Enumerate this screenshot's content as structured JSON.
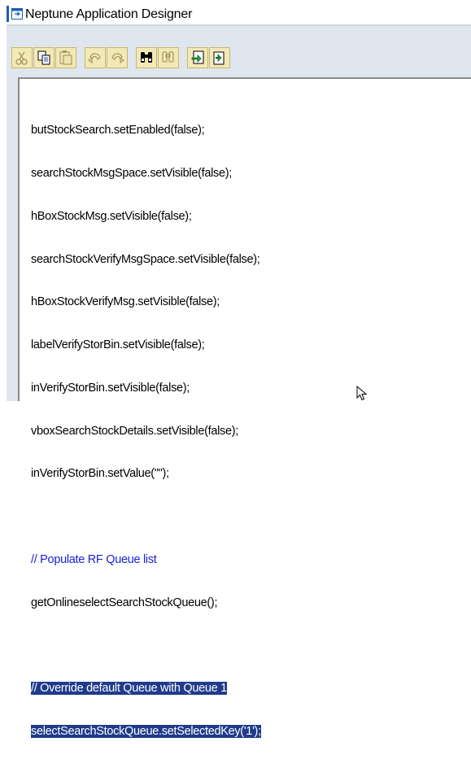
{
  "window": {
    "title": "Neptune Application Designer"
  },
  "toolbar": {
    "buttons": [
      {
        "name": "cut",
        "enabled": false
      },
      {
        "name": "copy",
        "enabled": true
      },
      {
        "name": "paste",
        "enabled": false
      },
      {
        "name": "undo",
        "enabled": false
      },
      {
        "name": "redo",
        "enabled": false
      },
      {
        "name": "find",
        "enabled": true
      },
      {
        "name": "find-replace",
        "enabled": false
      },
      {
        "name": "pretty-print",
        "enabled": true
      },
      {
        "name": "insert-pattern",
        "enabled": true
      }
    ]
  },
  "editor": {
    "lines": [
      "butStockSearch.setEnabled(false);",
      "searchStockMsgSpace.setVisible(false);",
      "hBoxStockMsg.setVisible(false);",
      "searchStockVerifyMsgSpace.setVisible(false);",
      "hBoxStockVerifyMsg.setVisible(false);",
      "labelVerifyStorBin.setVisible(false);",
      "inVerifyStorBin.setVisible(false);",
      "vboxSearchStockDetails.setVisible(false);",
      "inVerifyStorBin.setValue(\"\");",
      "",
      "// Populate RF Queue list",
      "getOnlineselectSearchStockQueue();",
      "",
      "// Override default Queue with Queue 1",
      "selectSearchStockQueue.setSelectedKey('1');"
    ]
  },
  "colors": {
    "comment": "#1a23d6",
    "selection": "#1f3b8a",
    "toolbar_button": "#f3e9b7",
    "shell_background": "#dfe6ee"
  }
}
